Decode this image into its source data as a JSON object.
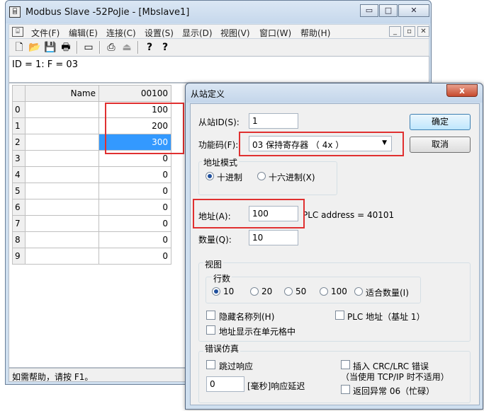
{
  "window": {
    "title": "Modbus Slave -52PoJie - [Mbslave1]",
    "app_icon_text": "⌸",
    "controls": {
      "minimize": "▭",
      "maximize": "□",
      "close": "✕"
    }
  },
  "menubar": {
    "doc_icon_text": "⌸",
    "items": [
      "文件(F)",
      "编辑(E)",
      "连接(C)",
      "设置(S)",
      "显示(D)",
      "视图(V)",
      "窗口(W)",
      "帮助(H)"
    ],
    "mdi_controls": {
      "minimize": "_",
      "restore": "▫",
      "close": "✕"
    }
  },
  "toolbar": {
    "icons": {
      "new": "🗋",
      "open": "📂",
      "save": "💾",
      "print": "🖶",
      "window": "▭",
      "connect": "⎙",
      "disconnect": "⏏",
      "help": "?",
      "context_help": "?"
    }
  },
  "info_line": "ID = 1: F = 03",
  "grid": {
    "headers": {
      "name": "Name",
      "address": "00100"
    },
    "rows": [
      {
        "index": "0",
        "name": "",
        "value": "100"
      },
      {
        "index": "1",
        "name": "",
        "value": "200"
      },
      {
        "index": "2",
        "name": "",
        "value": "300"
      },
      {
        "index": "3",
        "name": "",
        "value": "0"
      },
      {
        "index": "4",
        "name": "",
        "value": "0"
      },
      {
        "index": "5",
        "name": "",
        "value": "0"
      },
      {
        "index": "6",
        "name": "",
        "value": "0"
      },
      {
        "index": "7",
        "name": "",
        "value": "0"
      },
      {
        "index": "8",
        "name": "",
        "value": "0"
      },
      {
        "index": "9",
        "name": "",
        "value": "0"
      }
    ],
    "selected_row": 2
  },
  "status_text": "如需帮助，请按 F1。",
  "dialog": {
    "title": "从站定义",
    "close_glyph": "x",
    "slave_id_label": "从站ID(S):",
    "slave_id_value": "1",
    "function_label": "功能码(F):",
    "function_value": "03 保持寄存器 （ 4x ）",
    "ok_button": "确定",
    "cancel_button": "取消",
    "address_mode": {
      "legend": "地址模式",
      "decimal": "十进制",
      "hex": "十六进制(X)",
      "selected": "decimal"
    },
    "address_label": "地址(A):",
    "address_value": "100",
    "plc_address": "PLC address = 40101",
    "quantity_label": "数量(Q):",
    "quantity_value": "10",
    "view": {
      "legend": "视图",
      "rows_legend": "行数",
      "row_options": [
        "10",
        "20",
        "50",
        "100",
        "适合数量(I)"
      ],
      "selected_row_option": "10",
      "hide_name_column": "隐藏名称列(H)",
      "plc_addresses": "PLC 地址（基址 1）",
      "address_in_cell": "地址显示在单元格中"
    },
    "error_sim": {
      "legend": "错误仿真",
      "skip_response": "跳过响应",
      "insert_crc_error": "插入 CRC/LRC 错误",
      "insert_crc_note": "（当使用 TCP/IP 时不适用）",
      "delay_value": "0",
      "delay_label": "[毫秒]响应延迟",
      "return_exception": "返回异常 06（忙碌）"
    }
  },
  "colors": {
    "highlight": "#e03030",
    "selection": "#3399ff",
    "chrome": "#cfdfef"
  }
}
